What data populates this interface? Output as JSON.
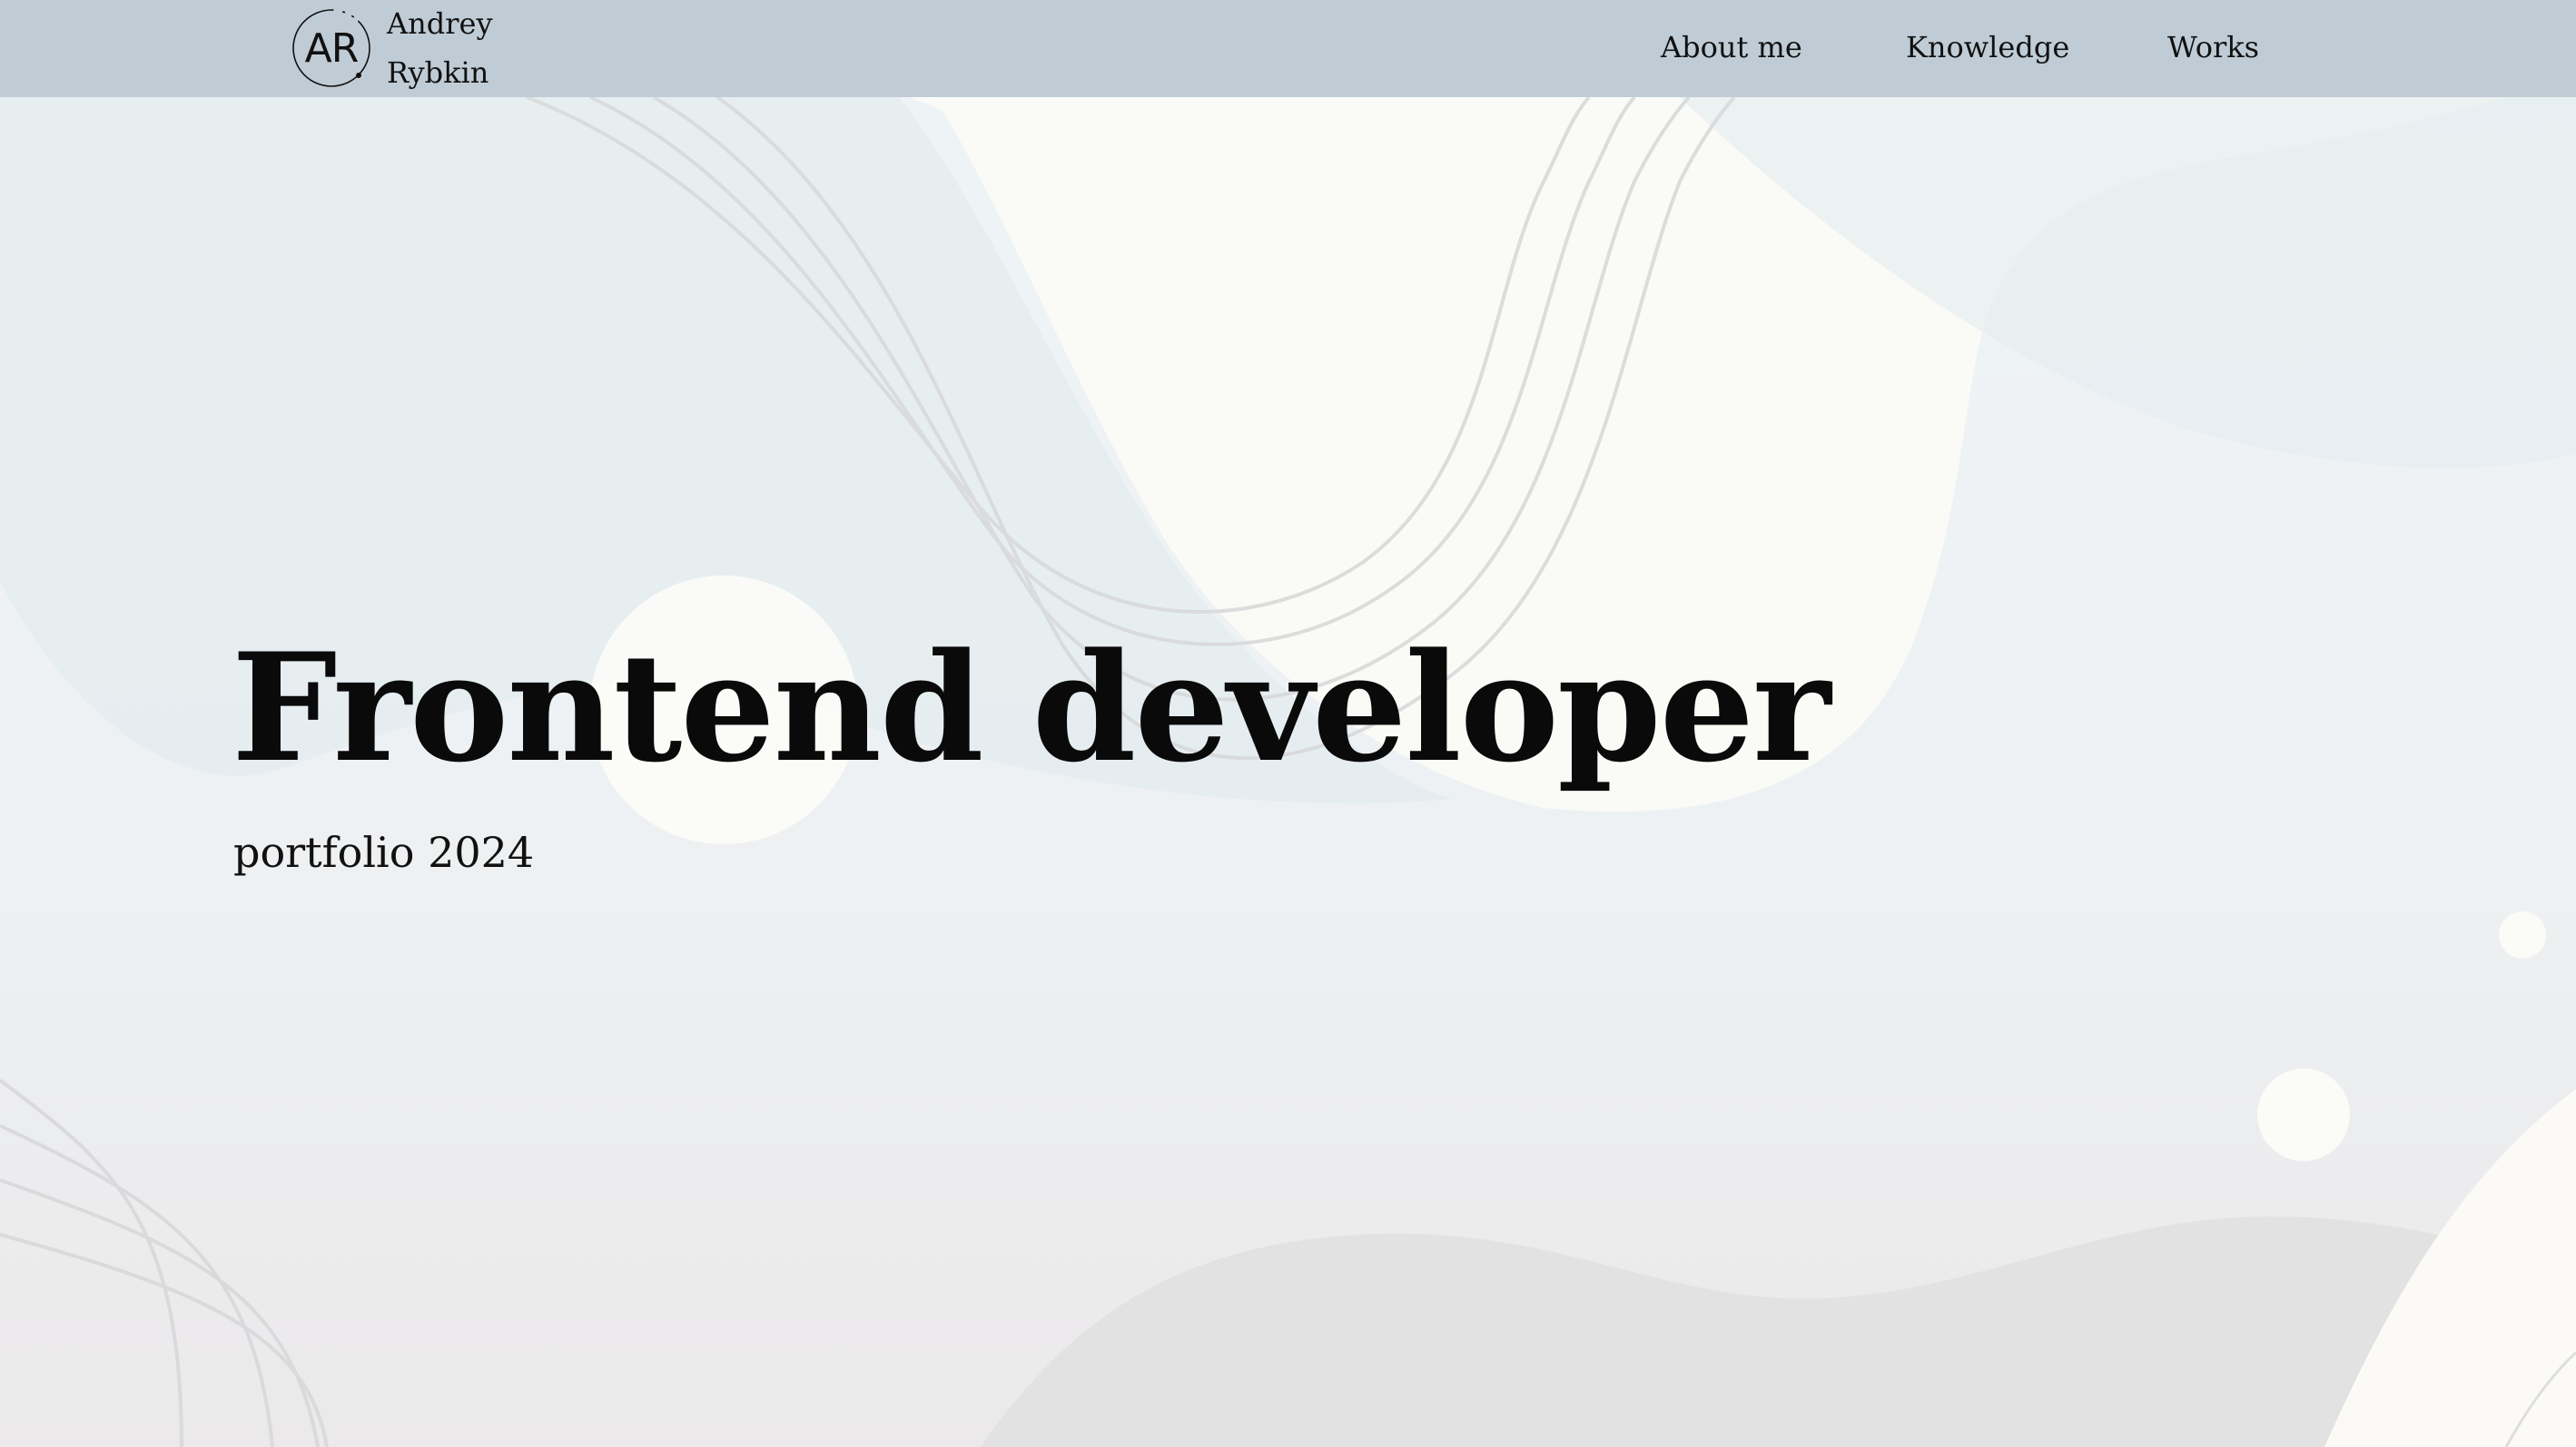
{
  "header": {
    "logo_text": "AR",
    "first_name": "Andrey",
    "last_name": "Rybkin",
    "nav": [
      {
        "label": "About me"
      },
      {
        "label": "Knowledge"
      },
      {
        "label": "Works"
      }
    ]
  },
  "hero": {
    "title": "Frontend developer",
    "subtitle": "portfolio 2024"
  },
  "colors": {
    "header_bg": "#c0ccd5",
    "text": "#0a0a0a"
  }
}
